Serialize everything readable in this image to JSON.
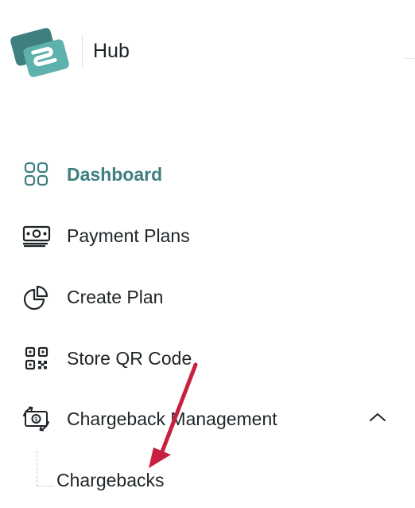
{
  "brand": {
    "name": "Hub",
    "logo_colors": [
      "#3f7f80",
      "#5eb1ad"
    ]
  },
  "sidebar": {
    "items": [
      {
        "label": "Dashboard",
        "icon": "grid-icon",
        "active": true
      },
      {
        "label": "Payment Plans",
        "icon": "banknote-icon",
        "active": false
      },
      {
        "label": "Create Plan",
        "icon": "pie-chart-icon",
        "active": false
      },
      {
        "label": "Store QR Code",
        "icon": "qr-code-icon",
        "active": false
      },
      {
        "label": "Chargeback Management",
        "icon": "currency-exchange-icon",
        "active": false,
        "expanded": true,
        "toggle_icon": "chevron-up-icon"
      }
    ],
    "subitems": [
      {
        "label": "Chargebacks"
      }
    ]
  },
  "colors": {
    "accent": "#3e7f80",
    "annotation_arrow": "#c8203f",
    "text": "#1f2428"
  }
}
